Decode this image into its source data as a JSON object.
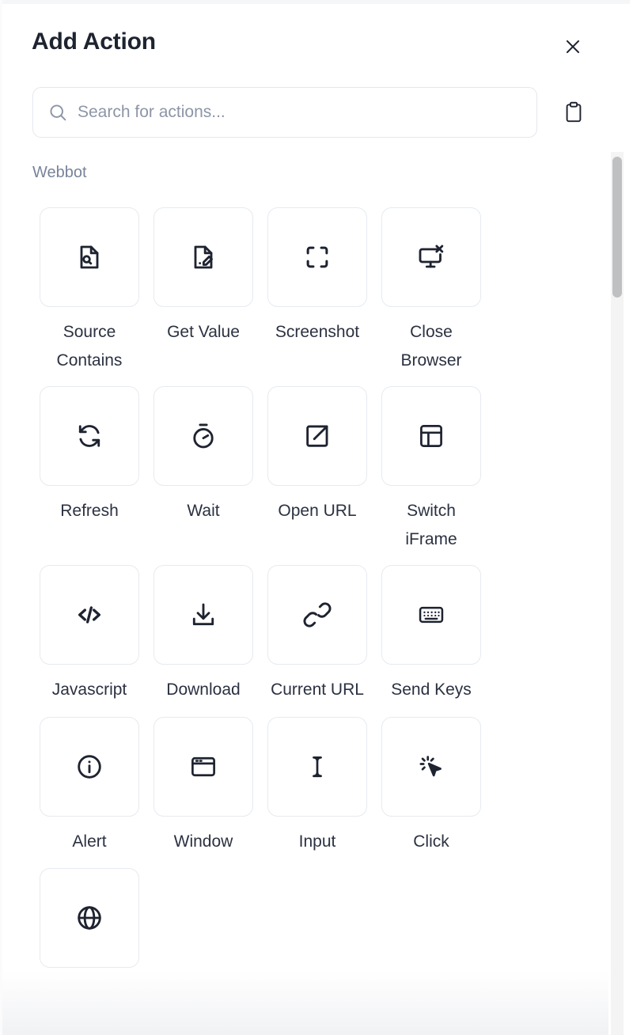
{
  "dialog": {
    "title": "Add Action",
    "close_label": "×",
    "close_icon": "close-icon"
  },
  "search": {
    "placeholder": "Search for actions...",
    "value": "",
    "icon": "search-icon",
    "clipboard_icon": "clipboard-icon"
  },
  "groups": [
    {
      "label": "Webbot",
      "actions": [
        {
          "label": "Source Contains",
          "icon": "file-search-icon"
        },
        {
          "label": "Get Value",
          "icon": "file-pen-icon"
        },
        {
          "label": "Screenshot",
          "icon": "crop-frame-icon"
        },
        {
          "label": "Close Browser",
          "icon": "monitor-x-icon"
        },
        {
          "label": "Refresh",
          "icon": "refresh-cw-icon"
        },
        {
          "label": "Wait",
          "icon": "stopwatch-icon"
        },
        {
          "label": "Open URL",
          "icon": "external-link-icon"
        },
        {
          "label": "Switch iFrame",
          "icon": "layout-panel-icon"
        },
        {
          "label": "Javascript",
          "icon": "code-brackets-icon"
        },
        {
          "label": "Download",
          "icon": "download-icon"
        },
        {
          "label": "Current URL",
          "icon": "link-chain-icon"
        },
        {
          "label": "Send Keys",
          "icon": "keyboard-icon"
        },
        {
          "label": "Alert",
          "icon": "info-circle-icon"
        },
        {
          "label": "Window",
          "icon": "browser-window-icon"
        },
        {
          "label": "Input",
          "icon": "text-cursor-icon"
        },
        {
          "label": "Click",
          "icon": "cursor-click-icon"
        },
        {
          "label": "",
          "icon": "globe-icon"
        }
      ]
    }
  ],
  "colors": {
    "text": "#2b3141",
    "title": "#1e2330",
    "muted": "#78839a",
    "placeholder": "#8d95a6",
    "tile_border": "#e6eaf0",
    "input_border": "#e3e7ee",
    "scrollbar_thumb": "#bfc0c2",
    "scrollbar_track": "#f4f4f5",
    "background": "#ffffff"
  }
}
